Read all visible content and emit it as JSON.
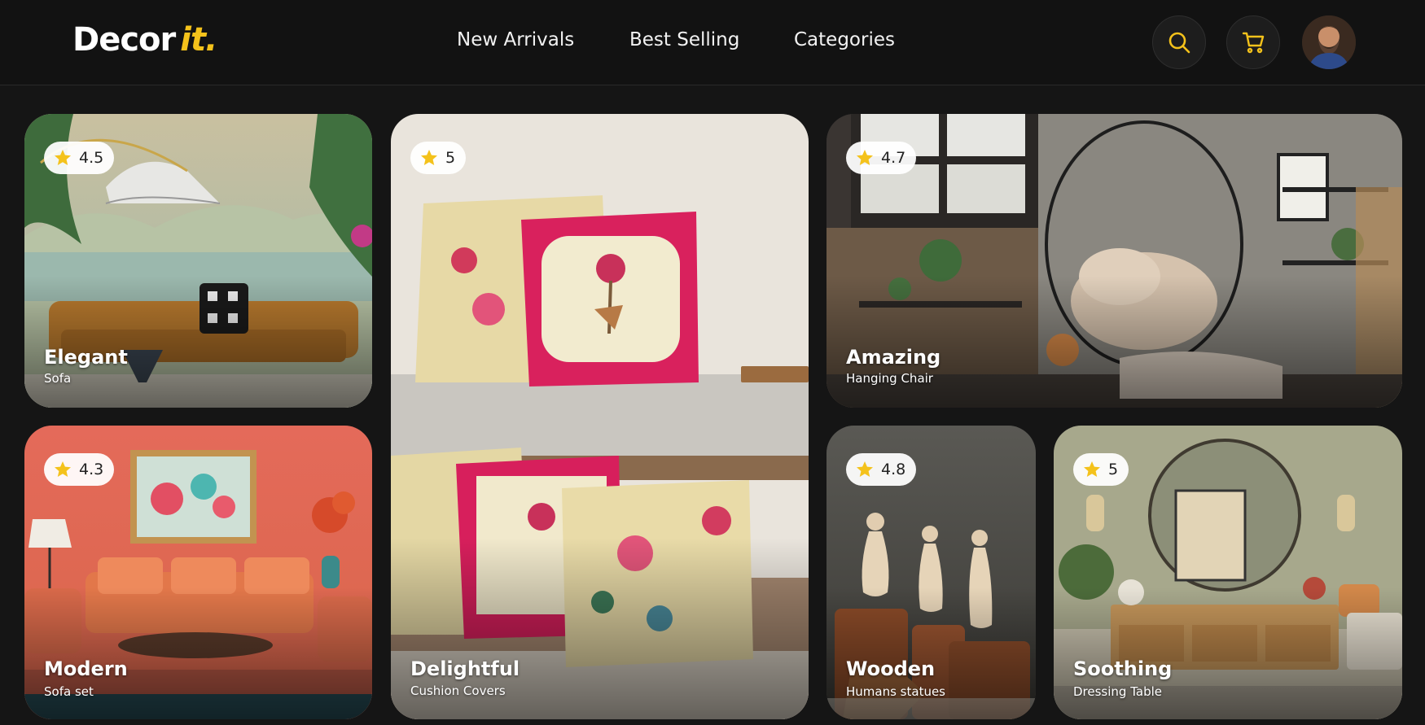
{
  "header": {
    "logo_main": "Decor",
    "logo_accent": "it.",
    "nav": [
      {
        "label": "New Arrivals"
      },
      {
        "label": "Best Selling"
      },
      {
        "label": "Categories"
      }
    ],
    "icons": {
      "search": "search-icon",
      "cart": "cart-icon",
      "profile": "avatar"
    }
  },
  "colors": {
    "background": "#151515",
    "accent": "#f4c21b",
    "text": "#f2f2f2",
    "star": "#f4c21b"
  },
  "cards": [
    {
      "rating": "4.5",
      "title": "Elegant",
      "subtitle": "Sofa"
    },
    {
      "rating": "5",
      "title": "Delightful",
      "subtitle": "Cushion Covers"
    },
    {
      "rating": "4.7",
      "title": "Amazing",
      "subtitle": "Hanging Chair"
    },
    {
      "rating": "4.3",
      "title": "Modern",
      "subtitle": "Sofa set"
    },
    {
      "rating": "4.8",
      "title": "Wooden",
      "subtitle": "Humans statues"
    },
    {
      "rating": "5",
      "title": "Soothing",
      "subtitle": "Dressing Table"
    }
  ]
}
